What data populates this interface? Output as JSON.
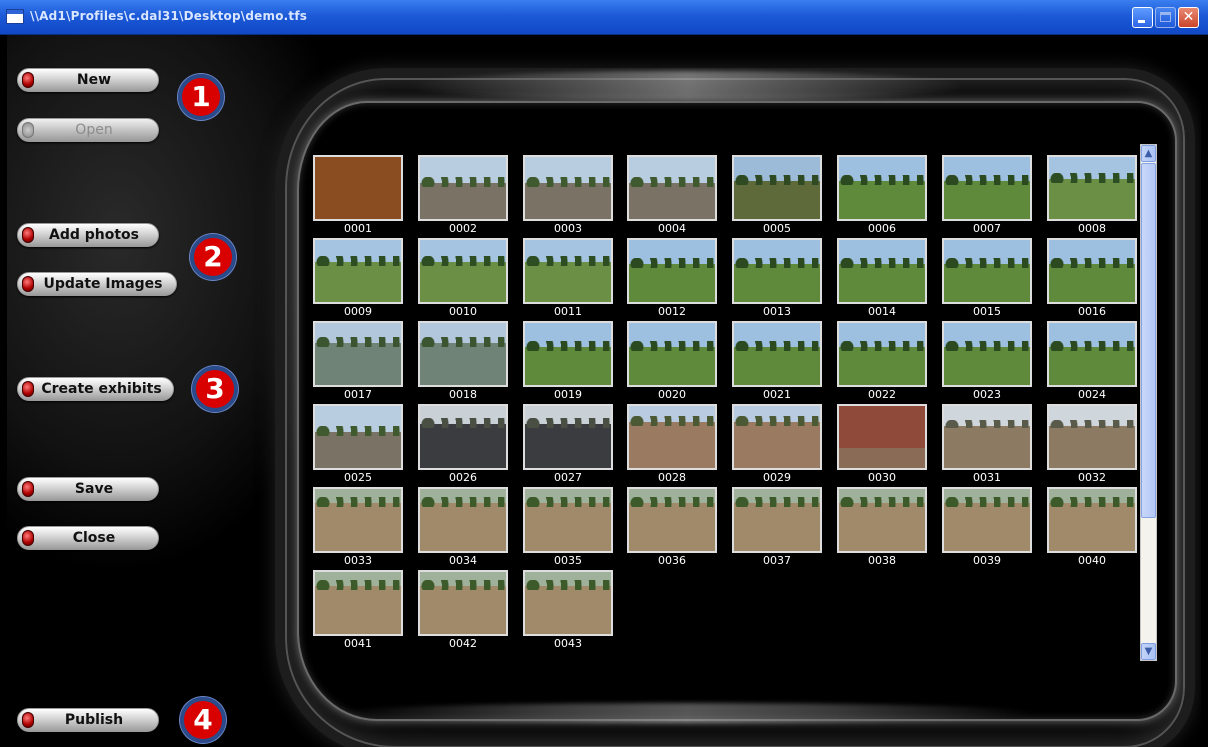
{
  "window": {
    "title": "\\\\Ad1\\Profiles\\c.dal31\\Desktop\\demo.tfs",
    "controls": [
      "minimize",
      "maximize",
      "close"
    ]
  },
  "buttons": {
    "new": "New",
    "open": "Open",
    "add_photos": "Add photos",
    "update_images": "Update Images",
    "create_exhibits": "Create exhibits",
    "save": "Save",
    "close": "Close",
    "publish": "Publish"
  },
  "steps": [
    "1",
    "2",
    "3",
    "4"
  ],
  "accent_colors": {
    "step_badge": "#d90000",
    "badge_ring": "#2a4a8a",
    "led": "#b00000"
  },
  "thumbnails": [
    {
      "label": "0001",
      "scene": "interior"
    },
    {
      "label": "0002",
      "scene": "street"
    },
    {
      "label": "0003",
      "scene": "street"
    },
    {
      "label": "0004",
      "scene": "street"
    },
    {
      "label": "0005",
      "scene": "road-field"
    },
    {
      "label": "0006",
      "scene": "field"
    },
    {
      "label": "0007",
      "scene": "field"
    },
    {
      "label": "0008",
      "scene": "park"
    },
    {
      "label": "0009",
      "scene": "park"
    },
    {
      "label": "0010",
      "scene": "park"
    },
    {
      "label": "0011",
      "scene": "park"
    },
    {
      "label": "0012",
      "scene": "field"
    },
    {
      "label": "0013",
      "scene": "field"
    },
    {
      "label": "0014",
      "scene": "field"
    },
    {
      "label": "0015",
      "scene": "field"
    },
    {
      "label": "0016",
      "scene": "field"
    },
    {
      "label": "0017",
      "scene": "flood"
    },
    {
      "label": "0018",
      "scene": "flood"
    },
    {
      "label": "0019",
      "scene": "field"
    },
    {
      "label": "0020",
      "scene": "field"
    },
    {
      "label": "0021",
      "scene": "field"
    },
    {
      "label": "0022",
      "scene": "field"
    },
    {
      "label": "0023",
      "scene": "field"
    },
    {
      "label": "0024",
      "scene": "field"
    },
    {
      "label": "0025",
      "scene": "street"
    },
    {
      "label": "0026",
      "scene": "truck"
    },
    {
      "label": "0027",
      "scene": "truck"
    },
    {
      "label": "0028",
      "scene": "house"
    },
    {
      "label": "0029",
      "scene": "house"
    },
    {
      "label": "0030",
      "scene": "brick"
    },
    {
      "label": "0031",
      "scene": "fence"
    },
    {
      "label": "0032",
      "scene": "fence"
    },
    {
      "label": "0033",
      "scene": "alley"
    },
    {
      "label": "0034",
      "scene": "alley"
    },
    {
      "label": "0035",
      "scene": "alley"
    },
    {
      "label": "0036",
      "scene": "alley"
    },
    {
      "label": "0037",
      "scene": "alley"
    },
    {
      "label": "0038",
      "scene": "alley"
    },
    {
      "label": "0039",
      "scene": "alley"
    },
    {
      "label": "0040",
      "scene": "alley"
    },
    {
      "label": "0041",
      "scene": "alley"
    },
    {
      "label": "0042",
      "scene": "alley"
    },
    {
      "label": "0043",
      "scene": "alley"
    }
  ]
}
